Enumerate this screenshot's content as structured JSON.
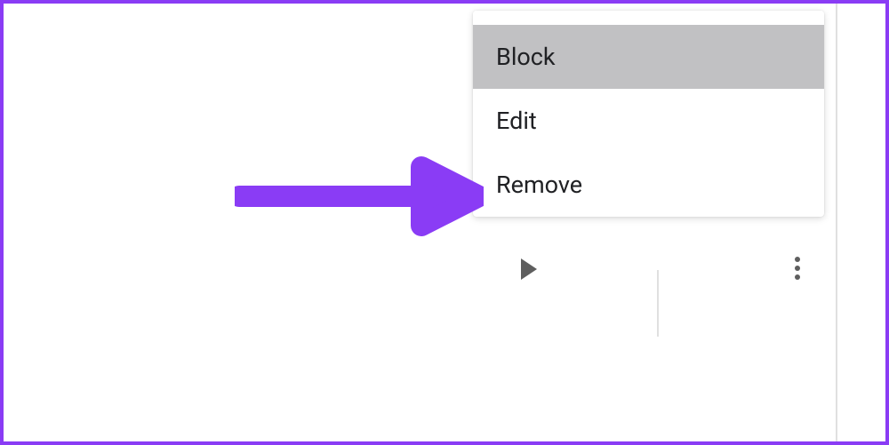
{
  "menu": {
    "items": [
      {
        "label": "Block",
        "selected": true
      },
      {
        "label": "Edit",
        "selected": false
      },
      {
        "label": "Remove",
        "selected": false
      }
    ]
  },
  "annotation": {
    "arrow_color": "#8a3cf5",
    "border_color": "#8a3cf5"
  }
}
